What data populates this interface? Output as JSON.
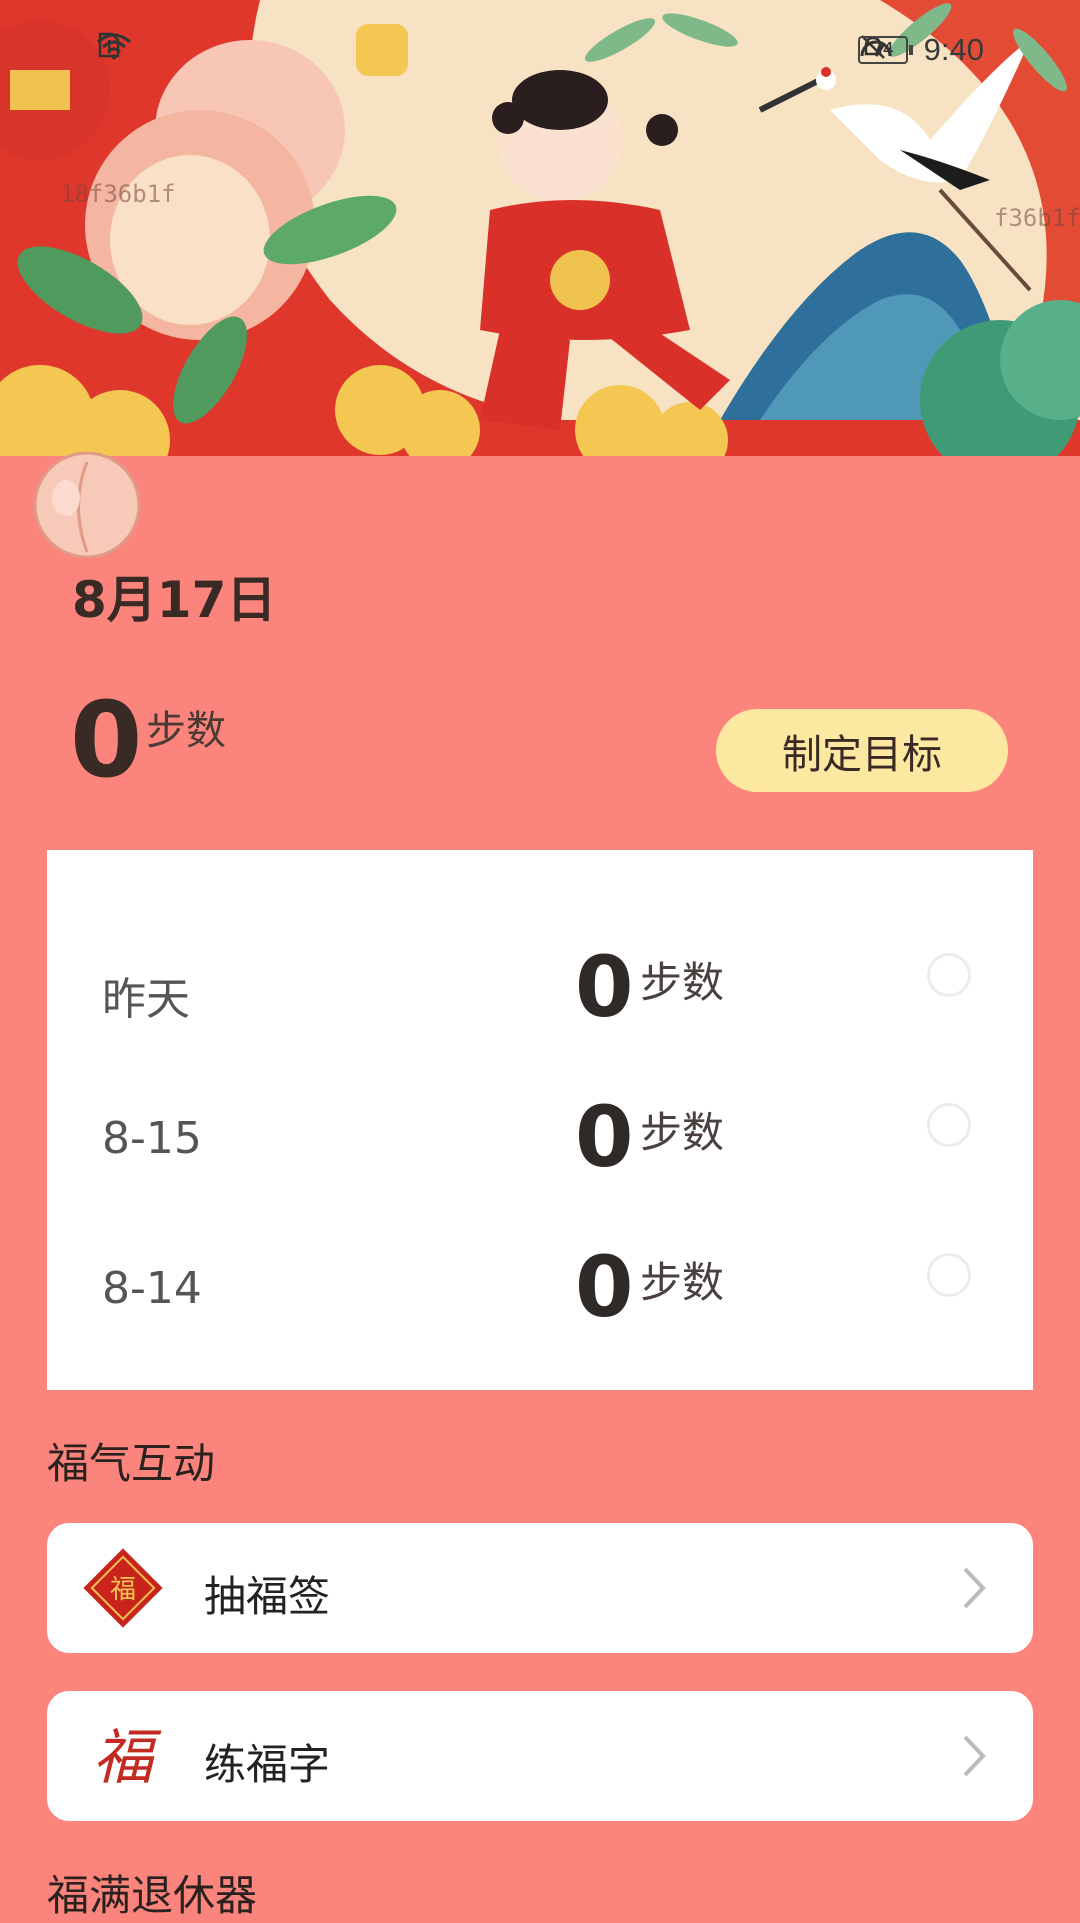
{
  "status_bar": {
    "time": "9:40",
    "battery": "74"
  },
  "watermarks": [
    "18f36b1f",
    "f36b1f"
  ],
  "summary": {
    "date": "8月17日",
    "today_steps": "0",
    "steps_unit": "步数",
    "goal_button": "制定目标"
  },
  "history": [
    {
      "label": "昨天",
      "steps": "0",
      "unit": "步数"
    },
    {
      "label": "8-15",
      "steps": "0",
      "unit": "步数"
    },
    {
      "label": "8-14",
      "steps": "0",
      "unit": "步数"
    }
  ],
  "interactions": {
    "title": "福气互动",
    "items": [
      {
        "label": "抽福签",
        "icon": "fu-diamond-icon"
      },
      {
        "label": "练福字",
        "icon": "fu-calligraphy-icon"
      }
    ]
  },
  "next_section": {
    "title": "福满退休器"
  },
  "colors": {
    "background": "#fb857c",
    "goal_button": "#fde8a2",
    "card": "#ffffff"
  }
}
